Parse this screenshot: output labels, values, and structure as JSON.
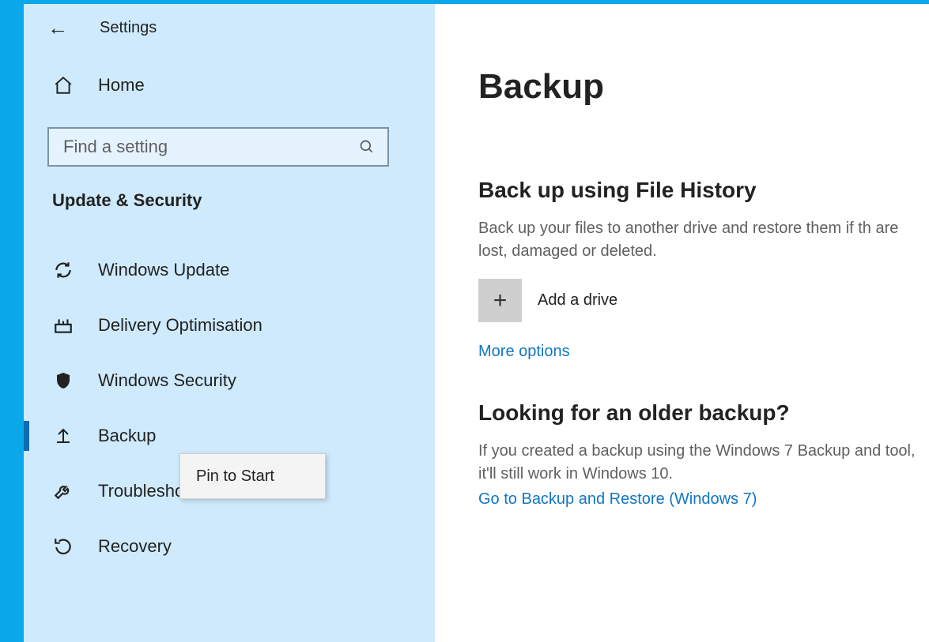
{
  "header": {
    "title": "Settings"
  },
  "sidebar": {
    "home": "Home",
    "search_placeholder": "Find a setting",
    "category": "Update & Security",
    "items": [
      {
        "label": "Windows Update"
      },
      {
        "label": "Delivery Optimisation"
      },
      {
        "label": "Windows Security"
      },
      {
        "label": "Backup"
      },
      {
        "label": "Troubleshoot"
      },
      {
        "label": "Recovery"
      }
    ]
  },
  "context_menu": {
    "pin": "Pin to Start"
  },
  "main": {
    "title": "Backup",
    "section1": {
      "title": "Back up using File History",
      "desc": "Back up your files to another drive and restore them if th are lost, damaged or deleted.",
      "add_drive": "Add a drive",
      "more_options": "More options"
    },
    "section2": {
      "title": "Looking for an older backup?",
      "desc": "If you created a backup using the Windows 7 Backup and tool, it'll still work in Windows 10.",
      "link": "Go to Backup and Restore (Windows 7)"
    }
  }
}
